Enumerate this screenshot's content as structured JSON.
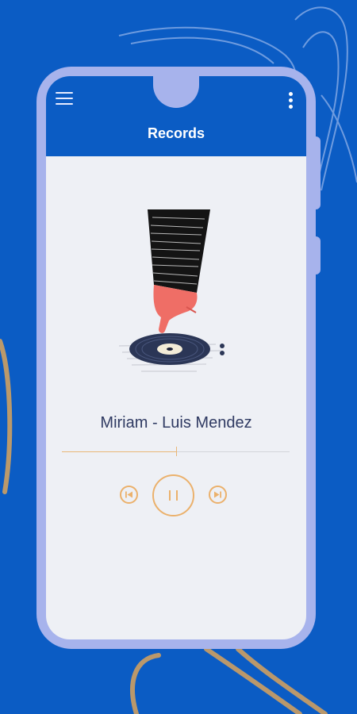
{
  "app": {
    "title": "Records"
  },
  "player": {
    "track_title": "Miriam - Luis Mendez",
    "progress": 0.5,
    "state": "playing"
  },
  "icons": {
    "menu": "menu-icon",
    "more": "more-vertical-icon",
    "prev": "skip-previous-icon",
    "pause": "pause-icon",
    "next": "skip-next-icon"
  },
  "colors": {
    "brand": "#0b5cc4",
    "frame": "#a7b3ec",
    "accent": "#ebb16c",
    "text": "#2f3a62"
  }
}
